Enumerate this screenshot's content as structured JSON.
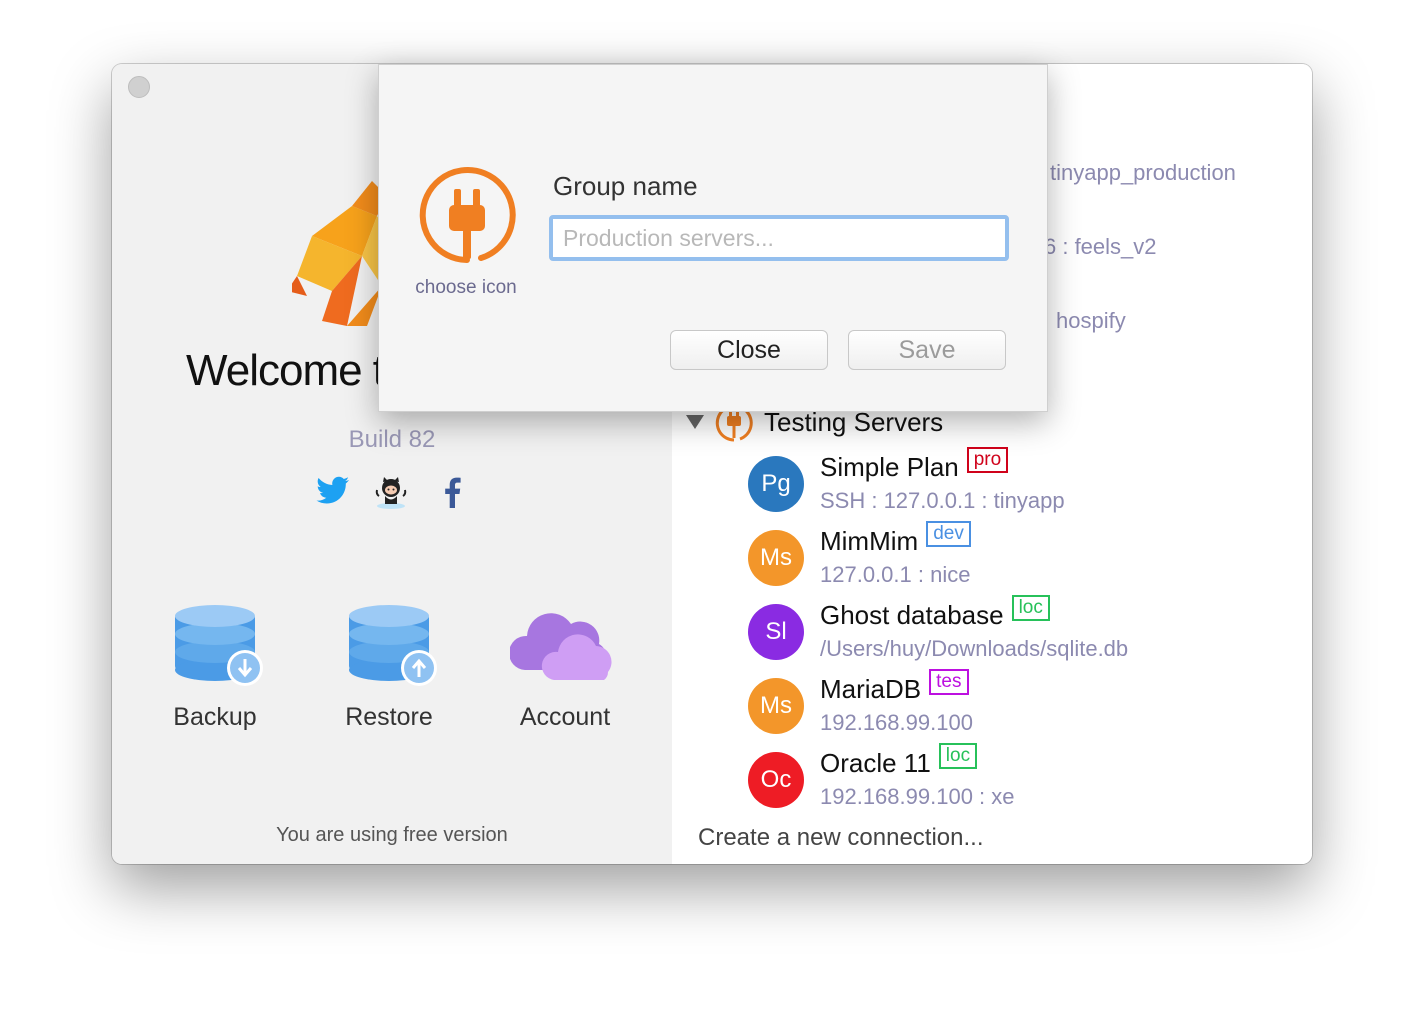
{
  "welcome": {
    "title": "Welcome t",
    "build": "Build 82",
    "actions": [
      {
        "label": "Backup"
      },
      {
        "label": "Restore"
      },
      {
        "label": "Account"
      }
    ],
    "free_note": "You are using free version"
  },
  "behind_dialog": {
    "row1": "tinyapp_production",
    "row2": "6 : feels_v2",
    "row3": "hospify"
  },
  "group": {
    "title": "Testing Servers",
    "connections": [
      {
        "initials": "Pg",
        "name": "Simple Plan",
        "badge": "pro",
        "detail": "SSH : 127.0.0.1 : tinyapp",
        "color": "#2a78be",
        "badge_color": "#d0021b"
      },
      {
        "initials": "Ms",
        "name": "MimMim",
        "badge": "dev",
        "detail": "127.0.0.1 : nice",
        "color": "#f3962a",
        "badge_color": "#4a90e2"
      },
      {
        "initials": "Sl",
        "name": "Ghost database",
        "badge": "loc",
        "detail": "/Users/huy/Downloads/sqlite.db",
        "color": "#8a2be2",
        "badge_color": "#27c15a"
      },
      {
        "initials": "Ms",
        "name": "MariaDB",
        "badge": "tes",
        "detail": "192.168.99.100",
        "color": "#f3962a",
        "badge_color": "#bd10e0"
      },
      {
        "initials": "Oc",
        "name": "Oracle 11",
        "badge": "loc",
        "detail": "192.168.99.100 : xe",
        "color": "#ee1c25",
        "badge_color": "#27c15a"
      }
    ],
    "create_label": "Create a new connection..."
  },
  "dialog": {
    "choose_icon": "choose icon",
    "group_name_label": "Group name",
    "group_name_value": "",
    "group_name_placeholder": "Production servers...",
    "close_label": "Close",
    "save_label": "Save"
  },
  "colors": {
    "accent_orange": "#f07f22",
    "muted_text": "#8c8ab0"
  }
}
